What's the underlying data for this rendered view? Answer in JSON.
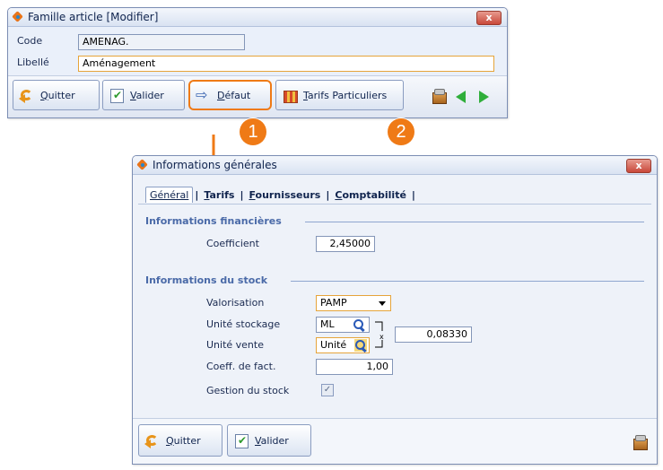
{
  "window1": {
    "title": "Famille article [Modifier]",
    "close_label": "x",
    "code_label": "Code",
    "code_value": "AMENAG.",
    "libelle_label": "Libellé",
    "libelle_value": "Aménagement",
    "buttons": {
      "quit_first": "Q",
      "quit_rest": "uitter",
      "valid_first": "V",
      "valid_rest": "alider",
      "default_first": "D",
      "default_rest": "éfaut",
      "tarifs_first": "T",
      "tarifs_rest": "arifs Particuliers"
    }
  },
  "badges": [
    "1",
    "2"
  ],
  "window2": {
    "title": "Informations générales",
    "close_label": "x",
    "tabs": {
      "general": "Général",
      "tarifs_first": "T",
      "tarifs_rest": "arifs",
      "fournisseurs_first": "F",
      "fournisseurs_rest": "ournisseurs",
      "comptabilite_first": "C",
      "comptabilite_rest": "omptabilité",
      "separator": "|"
    },
    "section_financial": "Informations financières",
    "coefficient_label": "Coefficient",
    "coefficient_value": "2,45000",
    "section_stock": "Informations du stock",
    "valorisation_label": "Valorisation",
    "valorisation_value": "PAMP",
    "unite_stockage_label": "Unité stockage",
    "unite_stockage_value": "ML",
    "unite_vente_label": "Unité vente",
    "unite_vente_value": "Unité",
    "conversion_value": "0,08330",
    "coeff_fact_label": "Coeff. de fact.",
    "coeff_fact_value": "1,00",
    "gestion_stock_label": "Gestion du stock",
    "gestion_stock_checked": true,
    "buttons": {
      "quit_first": "Q",
      "quit_rest": "uitter",
      "valid_first": "V",
      "valid_rest": "alider"
    }
  },
  "colors": {
    "accent_orange": "#ef7a16",
    "window_bg": "#eaf0fa",
    "section_blue": "#4a6aa8"
  },
  "icons": [
    "app-icon",
    "close-icon",
    "quit-icon",
    "validate-icon",
    "default-icon",
    "tarifs-icon",
    "package-icon",
    "arrow-left-icon",
    "arrow-right-icon",
    "search-icon",
    "dropdown-icon",
    "checkbox-icon"
  ]
}
